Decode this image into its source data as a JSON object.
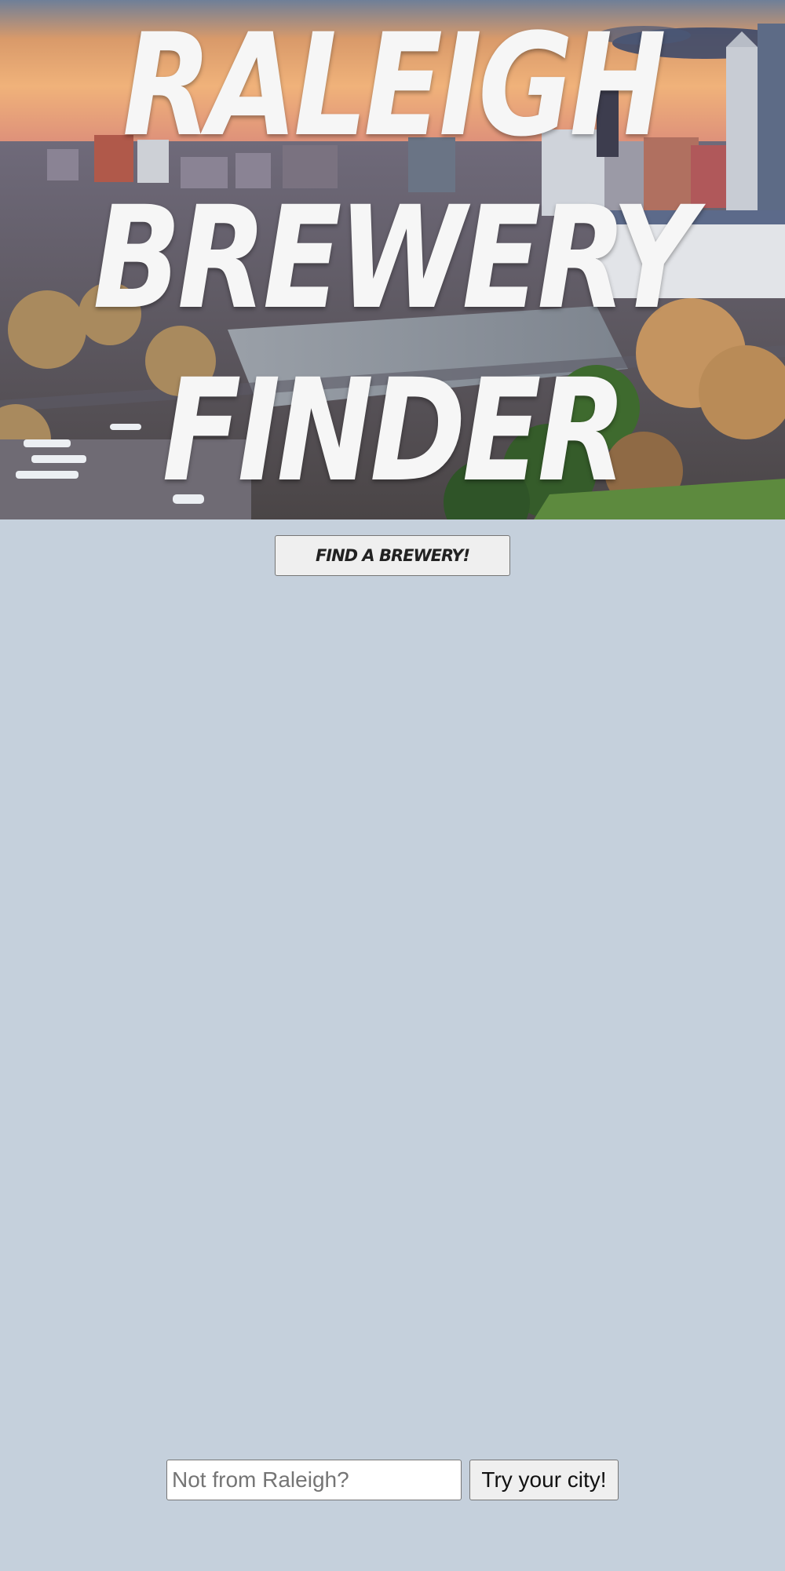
{
  "hero": {
    "title_line1": "Raleigh",
    "title_line2": "Brewery",
    "title_line3": "Finder",
    "image": "raleigh-skyline-photo"
  },
  "find_button": {
    "label": "Find a brewery!"
  },
  "city_search": {
    "placeholder": "Not from Raleigh?",
    "value": "",
    "button_label": "Try your city!"
  },
  "colors": {
    "page_background": "#c5d0dc",
    "title_text": "#f6f6f6",
    "button_background": "#efefef",
    "button_border": "#767676"
  }
}
